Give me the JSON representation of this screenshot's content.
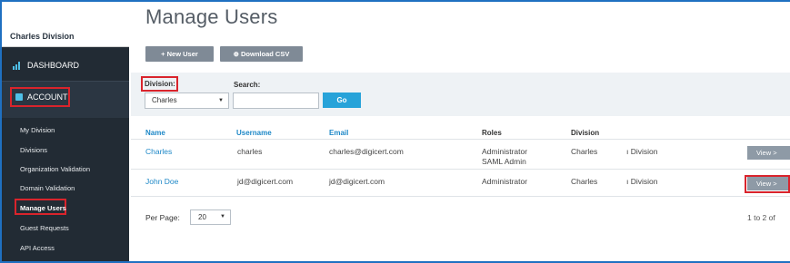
{
  "sidebar": {
    "org_name": "Charles Division",
    "dashboard_label": "DASHBOARD",
    "account_label": "ACCOUNT",
    "items": [
      {
        "label": "My Division"
      },
      {
        "label": "Divisions"
      },
      {
        "label": "Organization Validation"
      },
      {
        "label": "Domain Validation"
      },
      {
        "label": "Manage Users",
        "active": true
      },
      {
        "label": "Guest Requests"
      },
      {
        "label": "API Access"
      }
    ]
  },
  "page": {
    "title": "Manage Users"
  },
  "toolbar": {
    "new_user_label": "+ New User",
    "download_csv_label": "⊕ Download CSV"
  },
  "filters": {
    "division_label": "Division:",
    "division_value": "Charles",
    "search_label": "Search:",
    "search_value": "",
    "go_label": "Go"
  },
  "table": {
    "headers": [
      "Name",
      "Username",
      "Email",
      "Roles",
      "Division"
    ],
    "rows": [
      {
        "name": "Charles",
        "username": "charles",
        "email": "charles@digicert.com",
        "roles": [
          "Administrator",
          "SAML Admin"
        ],
        "division": "Charles",
        "division2": "ı Division",
        "action": "View >"
      },
      {
        "name": "John Doe",
        "username": "jd@digicert.com",
        "email": "jd@digicert.com",
        "roles": [
          "Administrator"
        ],
        "division": "Charles",
        "division2": "ı Division",
        "action": "View >"
      }
    ]
  },
  "pagination": {
    "per_page_label": "Per Page:",
    "per_page_value": "20",
    "range_text": "1 to 2 of"
  },
  "colors": {
    "accent": "#1e88c7",
    "go_button": "#27a3d9",
    "highlight": "#d9242c",
    "sidebar": "#2b3642"
  }
}
